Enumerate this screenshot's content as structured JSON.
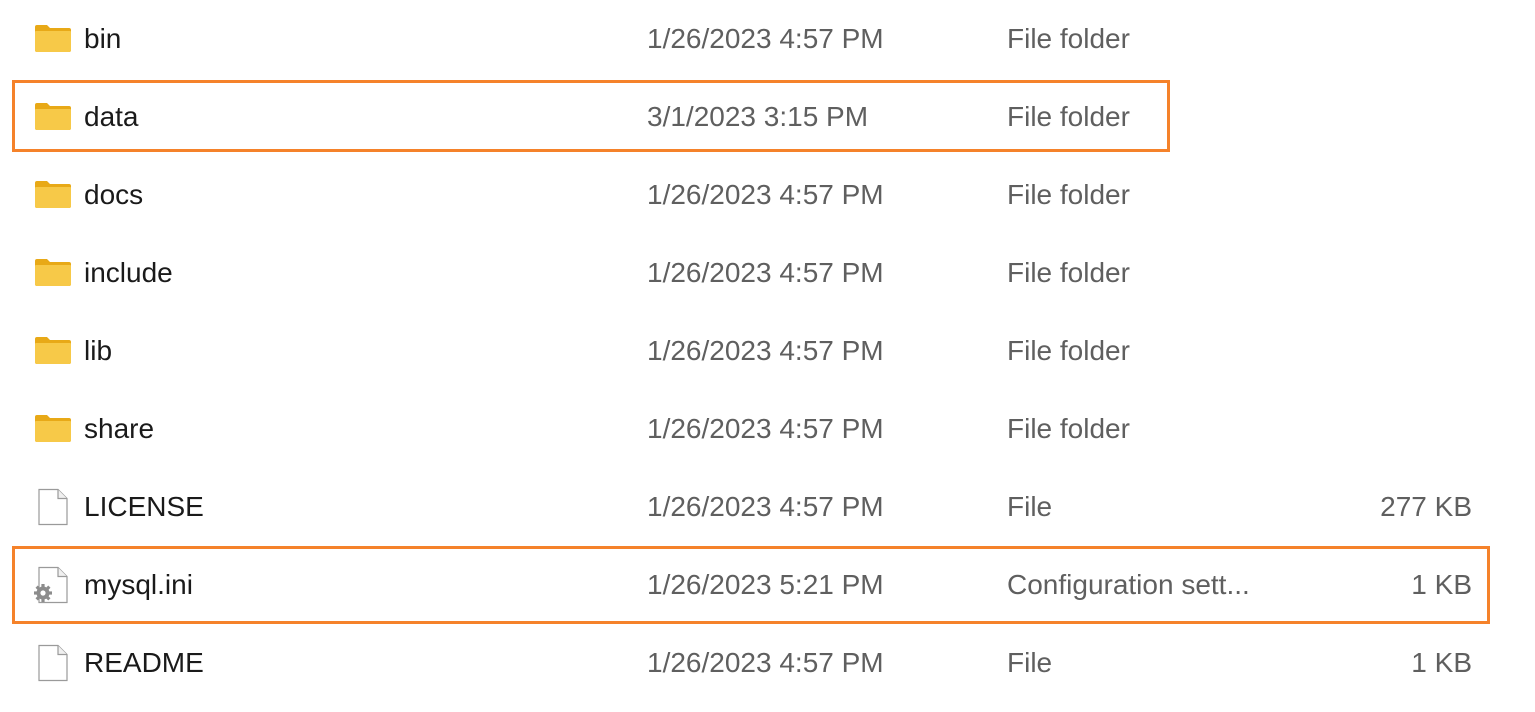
{
  "rows": [
    {
      "name": "bin",
      "date": "1/26/2023 4:57 PM",
      "type": "File folder",
      "size": "",
      "icon": "folder-icon"
    },
    {
      "name": "data",
      "date": "3/1/2023 3:15 PM",
      "type": "File folder",
      "size": "",
      "icon": "folder-icon"
    },
    {
      "name": "docs",
      "date": "1/26/2023 4:57 PM",
      "type": "File folder",
      "size": "",
      "icon": "folder-icon"
    },
    {
      "name": "include",
      "date": "1/26/2023 4:57 PM",
      "type": "File folder",
      "size": "",
      "icon": "folder-icon"
    },
    {
      "name": "lib",
      "date": "1/26/2023 4:57 PM",
      "type": "File folder",
      "size": "",
      "icon": "folder-icon"
    },
    {
      "name": "share",
      "date": "1/26/2023 4:57 PM",
      "type": "File folder",
      "size": "",
      "icon": "folder-icon"
    },
    {
      "name": "LICENSE",
      "date": "1/26/2023 4:57 PM",
      "type": "File",
      "size": "277 KB",
      "icon": "file-icon"
    },
    {
      "name": "mysql.ini",
      "date": "1/26/2023 5:21 PM",
      "type": "Configuration sett...",
      "size": "1 KB",
      "icon": "config-file-icon"
    },
    {
      "name": "README",
      "date": "1/26/2023 4:57 PM",
      "type": "File",
      "size": "1 KB",
      "icon": "file-icon"
    }
  ],
  "colors": {
    "highlight": "#f5822a",
    "folder": "#f7c948",
    "name_text": "#1a1a1a",
    "meta_text": "#5f5f5f"
  }
}
